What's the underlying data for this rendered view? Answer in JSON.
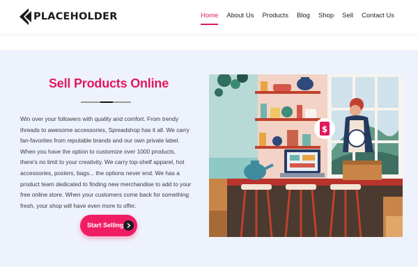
{
  "header": {
    "logo_text": "PLACEHOLDER",
    "nav": [
      {
        "label": "Home",
        "active": true
      },
      {
        "label": "About Us"
      },
      {
        "label": "Products"
      },
      {
        "label": "Blog"
      },
      {
        "label": "Shop"
      },
      {
        "label": "Sell"
      },
      {
        "label": "Contact Us"
      }
    ]
  },
  "hero": {
    "title": "Sell Products Online",
    "body": "Win over your followers with quality and comfort. From trendy threads to awesome accessories, Spreadshop has it all. We carry fan-favorites from reputable brands and our own private label. When you have the option to customize over 1000 products, there's no limit to your creativity. We carry top-shelf apparel, hot accessories, posters, bags... the options never end. We has a product team dedicated to finding new merchandise to add to your free online store. When your customers come back for something fresh, your shop will have even more to offer.",
    "cta_label": "Start Selling",
    "illustration_sign": "$"
  },
  "colors": {
    "accent": "#e2185d",
    "button": "#f01d64",
    "section_bg": "#eef2fc"
  },
  "icons": {
    "logo": "logo-mark-icon",
    "cta": "arrow-right-icon"
  }
}
